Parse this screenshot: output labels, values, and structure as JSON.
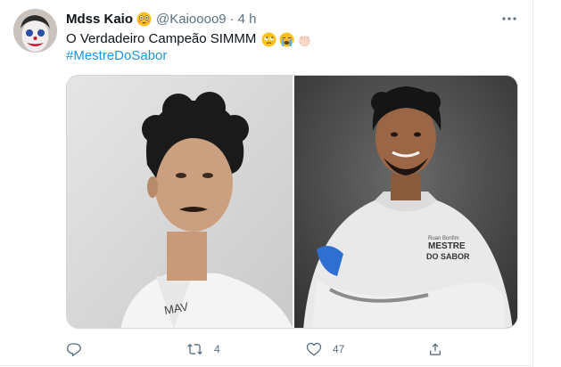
{
  "tweet": {
    "display_name": "Mdss Kaio",
    "name_emoji": "flushed-face-emoji",
    "handle": "@Kaioooo9",
    "separator": "·",
    "time": "4 h",
    "text": "O Verdadeiro Campeão SIMMM",
    "text_emojis": [
      "rolling-eyes-emoji",
      "crying-face-emoji",
      "raised-fist-emoji"
    ],
    "hashtag": "#MestreDoSabor",
    "media_count": 2
  },
  "actions": {
    "reply_count": "",
    "retweet_count": "4",
    "like_count": "47",
    "share_count": ""
  },
  "colors": {
    "text": "#0f1419",
    "secondary": "#5b7083",
    "link": "#1b95e0",
    "border": "#e6ecf0"
  }
}
